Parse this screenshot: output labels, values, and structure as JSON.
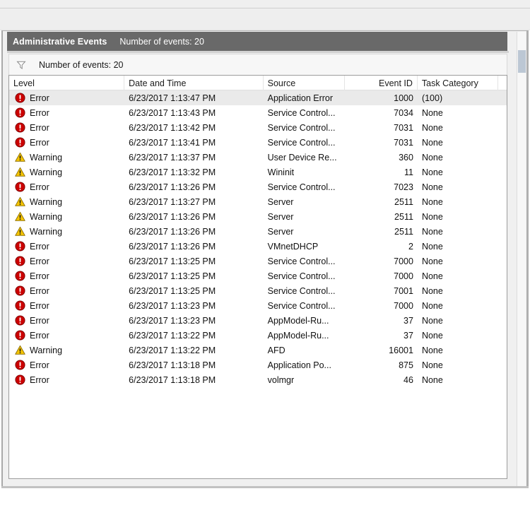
{
  "window": {
    "panel_title": "Administrative Events",
    "panel_count": "Number of events: 20"
  },
  "filter_bar": {
    "icon": "funnel-filter-icon",
    "label": "Number of events: 20"
  },
  "grid": {
    "columns": [
      {
        "key": "level",
        "label": "Level"
      },
      {
        "key": "date",
        "label": "Date and Time"
      },
      {
        "key": "source",
        "label": "Source"
      },
      {
        "key": "eid",
        "label": "Event ID"
      },
      {
        "key": "task",
        "label": "Task Category"
      }
    ],
    "rows": [
      {
        "level": "Error",
        "icon": "error-icon",
        "date": "6/23/2017 1:13:47 PM",
        "source": "Application Error",
        "eid": "1000",
        "task": "(100)",
        "selected": true
      },
      {
        "level": "Error",
        "icon": "error-icon",
        "date": "6/23/2017 1:13:43 PM",
        "source": "Service Control...",
        "eid": "7034",
        "task": "None",
        "selected": false
      },
      {
        "level": "Error",
        "icon": "error-icon",
        "date": "6/23/2017 1:13:42 PM",
        "source": "Service Control...",
        "eid": "7031",
        "task": "None",
        "selected": false
      },
      {
        "level": "Error",
        "icon": "error-icon",
        "date": "6/23/2017 1:13:41 PM",
        "source": "Service Control...",
        "eid": "7031",
        "task": "None",
        "selected": false
      },
      {
        "level": "Warning",
        "icon": "warning-icon",
        "date": "6/23/2017 1:13:37 PM",
        "source": "User Device Re...",
        "eid": "360",
        "task": "None",
        "selected": false
      },
      {
        "level": "Warning",
        "icon": "warning-icon",
        "date": "6/23/2017 1:13:32 PM",
        "source": "Wininit",
        "eid": "11",
        "task": "None",
        "selected": false
      },
      {
        "level": "Error",
        "icon": "error-icon",
        "date": "6/23/2017 1:13:26 PM",
        "source": "Service Control...",
        "eid": "7023",
        "task": "None",
        "selected": false
      },
      {
        "level": "Warning",
        "icon": "warning-icon",
        "date": "6/23/2017 1:13:27 PM",
        "source": "Server",
        "eid": "2511",
        "task": "None",
        "selected": false
      },
      {
        "level": "Warning",
        "icon": "warning-icon",
        "date": "6/23/2017 1:13:26 PM",
        "source": "Server",
        "eid": "2511",
        "task": "None",
        "selected": false
      },
      {
        "level": "Warning",
        "icon": "warning-icon",
        "date": "6/23/2017 1:13:26 PM",
        "source": "Server",
        "eid": "2511",
        "task": "None",
        "selected": false
      },
      {
        "level": "Error",
        "icon": "error-icon",
        "date": "6/23/2017 1:13:26 PM",
        "source": "VMnetDHCP",
        "eid": "2",
        "task": "None",
        "selected": false
      },
      {
        "level": "Error",
        "icon": "error-icon",
        "date": "6/23/2017 1:13:25 PM",
        "source": "Service Control...",
        "eid": "7000",
        "task": "None",
        "selected": false
      },
      {
        "level": "Error",
        "icon": "error-icon",
        "date": "6/23/2017 1:13:25 PM",
        "source": "Service Control...",
        "eid": "7000",
        "task": "None",
        "selected": false
      },
      {
        "level": "Error",
        "icon": "error-icon",
        "date": "6/23/2017 1:13:25 PM",
        "source": "Service Control...",
        "eid": "7001",
        "task": "None",
        "selected": false
      },
      {
        "level": "Error",
        "icon": "error-icon",
        "date": "6/23/2017 1:13:23 PM",
        "source": "Service Control...",
        "eid": "7000",
        "task": "None",
        "selected": false
      },
      {
        "level": "Error",
        "icon": "error-icon",
        "date": "6/23/2017 1:13:23 PM",
        "source": "AppModel-Ru...",
        "eid": "37",
        "task": "None",
        "selected": false
      },
      {
        "level": "Error",
        "icon": "error-icon",
        "date": "6/23/2017 1:13:22 PM",
        "source": "AppModel-Ru...",
        "eid": "37",
        "task": "None",
        "selected": false
      },
      {
        "level": "Warning",
        "icon": "warning-icon",
        "date": "6/23/2017 1:13:22 PM",
        "source": "AFD",
        "eid": "16001",
        "task": "None",
        "selected": false
      },
      {
        "level": "Error",
        "icon": "error-icon",
        "date": "6/23/2017 1:13:18 PM",
        "source": "Application Po...",
        "eid": "875",
        "task": "None",
        "selected": false
      },
      {
        "level": "Error",
        "icon": "error-icon",
        "date": "6/23/2017 1:13:18 PM",
        "source": "volmgr",
        "eid": "46",
        "task": "None",
        "selected": false
      }
    ]
  },
  "colors": {
    "error": "#cc0000",
    "warning": "#f5c400",
    "caption_bar": "#696969",
    "selection": "#eaeaea",
    "scroll_thumb": "#bcc7d4"
  }
}
